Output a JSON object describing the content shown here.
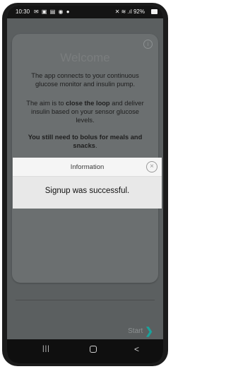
{
  "status_bar": {
    "time": "10:30",
    "left_icons": "✉ ▣ ▤ ◉ ●",
    "right_icons": "✕ ≋ .ıl 92%",
    "battery_icon": "battery-icon"
  },
  "welcome": {
    "title": "Welcome",
    "paragraph1": "The app connects to your continuous glucose monitor and insulin pump.",
    "paragraph2_pre": "The aim is to ",
    "paragraph2_bold": "close the loop",
    "paragraph2_post": " and deliver insulin based on your sensor glucose levels.",
    "paragraph3": "You still need to bolus for meals and snacks",
    "paragraph3_end": "."
  },
  "footer": {
    "start_label": "Start",
    "start_chevron": "❯"
  },
  "dialog": {
    "title": "Information",
    "message": "Signup was successful.",
    "close_glyph": "×"
  },
  "nav": {
    "recent": "|||",
    "back": "<"
  },
  "colors": {
    "accent": "#1aa39c",
    "overlay": "#5b5f60"
  }
}
